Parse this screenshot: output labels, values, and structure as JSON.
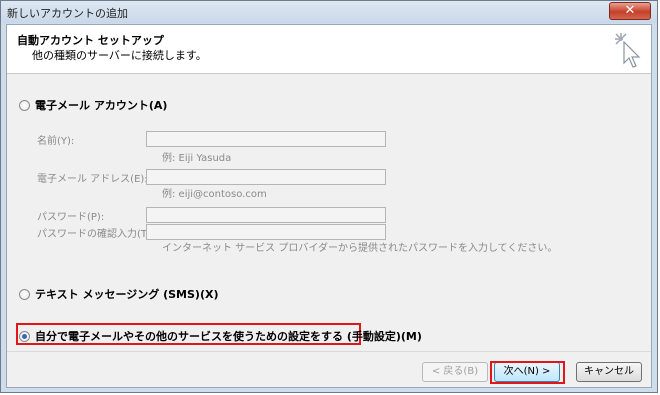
{
  "window": {
    "title": "新しいアカウントの追加"
  },
  "header": {
    "title": "自動アカウント セットアップ",
    "subtitle": "他の種類のサーバーに接続します。"
  },
  "options": {
    "email_account": "電子メール アカウント(A)",
    "sms": "テキスト メッセージング (SMS)(X)",
    "manual": "自分で電子メールやその他のサービスを使うための設定をする (手動設定)(M)"
  },
  "form": {
    "name_label": "名前(Y):",
    "name_example": "例: Eiji Yasuda",
    "email_label": "電子メール アドレス(E):",
    "email_example": "例: eiji@contoso.com",
    "password_label": "パスワード(P):",
    "password_confirm_label": "パスワードの確認入力(T):",
    "password_note": "インターネット サービス プロバイダーから提供されたパスワードを入力してください。"
  },
  "buttons": {
    "back": "< 戻る(B)",
    "next": "次へ(N) >",
    "cancel": "キャンセル"
  },
  "selected_option": "manual",
  "colors": {
    "highlight": "#e0161b",
    "accent": "#2b6bb8"
  }
}
